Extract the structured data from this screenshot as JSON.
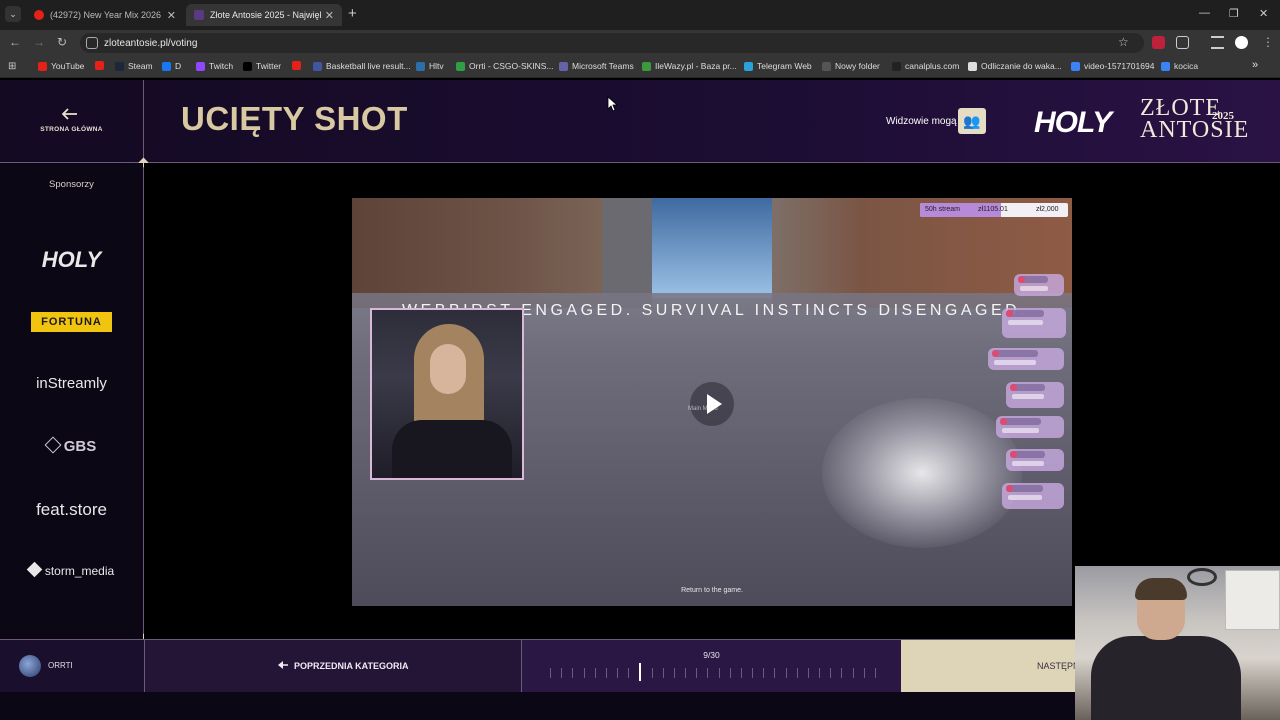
{
  "browser": {
    "tabs": [
      {
        "title": "(42972) New Year Mix 2026 | Th",
        "favicon_color": "#e62117",
        "active": false
      },
      {
        "title": "Złote Antosie 2025 - Największ",
        "favicon_color": "#2a1a40",
        "active": true
      }
    ],
    "new_tab": "+",
    "url": "zloteantosie.pl/voting",
    "bookmarks": [
      {
        "label": "YouTube",
        "color": "#e62117"
      },
      {
        "label": "",
        "color": "#e62117"
      },
      {
        "label": "Steam",
        "color": "#1b2838"
      },
      {
        "label": "D",
        "color": "#1877f2"
      },
      {
        "label": "Twitch",
        "color": "#9146ff"
      },
      {
        "label": "Twitter",
        "color": "#000000"
      },
      {
        "label": "",
        "color": "#e62117"
      },
      {
        "label": "Basketball live result...",
        "color": "#4056a1"
      },
      {
        "label": "Hltv",
        "color": "#2b6ea8"
      },
      {
        "label": "Orrti - CSGO-SKINS...",
        "color": "#2f9e44"
      },
      {
        "label": "Microsoft Teams",
        "color": "#6264a7"
      },
      {
        "label": "IleWazy.pl - Baza pr...",
        "color": "#3c9a3c"
      },
      {
        "label": "Telegram Web",
        "color": "#2aa1da"
      },
      {
        "label": "Nowy folder",
        "color": "#555555"
      },
      {
        "label": "canalplus.com",
        "color": "#222222"
      },
      {
        "label": "Odliczanie do waka...",
        "color": "#dddddd"
      },
      {
        "label": "video-1571701694",
        "color": "#3b82f6"
      },
      {
        "label": "kocica",
        "color": "#3b82f6"
      }
    ],
    "bookmarks_more": "»"
  },
  "header": {
    "home_label": "STRONA GŁÓWNA",
    "category_title": "UCIĘTY SHOT",
    "viewers_label": "Widzowie mogą",
    "logo_holy": "HOLY",
    "logo_zlote": "ZŁOTE",
    "logo_antosie": "ANTOSIE",
    "logo_year": "2025"
  },
  "sidebar": {
    "title": "Sponsorzy",
    "sponsors": [
      "HOLY",
      "FORTUNA",
      "inStreamly",
      "GBS",
      "feat.store",
      "storm_media"
    ]
  },
  "video": {
    "banner_text": "WEBBIRST ENGAGED. SURVIVAL INSTINCTS DISENGAGED.",
    "menu_hint": "Main Menu",
    "return_text": "Return to the game.",
    "goal_label": "50h stream",
    "goal_current": "zł1105.01",
    "goal_target": "zł2,000",
    "goal_progress": 0.55
  },
  "footer": {
    "user_name": "ORRTI",
    "prev_label": "POPRZEDNIA KATEGORIA",
    "progress_label": "9/30",
    "current_index": 9,
    "total": 30,
    "next_label": "NASTĘPN"
  },
  "colors": {
    "accent_gold": "#d9c9a3",
    "page_bg": "#0c0714",
    "next_bg": "#ded4b8"
  }
}
